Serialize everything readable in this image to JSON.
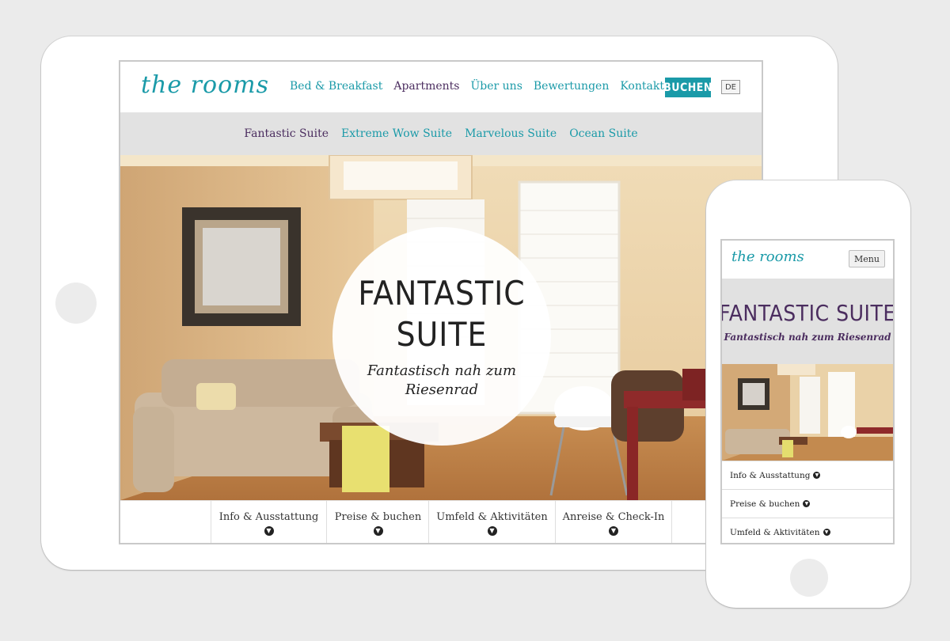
{
  "brand": {
    "logo_text": "the rooms",
    "accent": "#1a9aa8",
    "purple": "#4b2d5f"
  },
  "tablet": {
    "nav": [
      {
        "label": "Bed & Breakfast",
        "active": false
      },
      {
        "label": "Apartments",
        "active": true
      },
      {
        "label": "Über uns",
        "active": false
      },
      {
        "label": "Bewertungen",
        "active": false
      },
      {
        "label": "Kontakt",
        "active": false
      }
    ],
    "book_label": "BUCHEN",
    "lang_label": "DE",
    "suites": [
      {
        "label": "Fantastic Suite",
        "active": true
      },
      {
        "label": "Extreme Wow Suite",
        "active": false
      },
      {
        "label": "Marvelous Suite",
        "active": false
      },
      {
        "label": "Ocean Suite",
        "active": false
      }
    ],
    "hero": {
      "title_line1": "FANTASTIC",
      "title_line2": "SUITE",
      "subtitle": "Fantastisch nah zum Riesenrad"
    },
    "tabs": [
      {
        "label": "Info & Ausstattung",
        "icon": "chevron-down-icon"
      },
      {
        "label": "Preise & buchen",
        "icon": "chevron-down-icon"
      },
      {
        "label": "Umfeld & Aktivitäten",
        "icon": "chevron-down-icon"
      },
      {
        "label": "Anreise & Check-In",
        "icon": "chevron-down-icon"
      }
    ]
  },
  "phone": {
    "menu_label": "Menu",
    "title": "FANTASTIC SUITE",
    "subtitle": "Fantastisch nah zum Riesenrad",
    "items": [
      {
        "label": "Info & Ausstattung",
        "icon": "chevron-down-icon"
      },
      {
        "label": "Preise & buchen",
        "icon": "chevron-down-icon"
      },
      {
        "label": "Umfeld & Aktivitäten",
        "icon": "chevron-down-icon"
      }
    ]
  }
}
